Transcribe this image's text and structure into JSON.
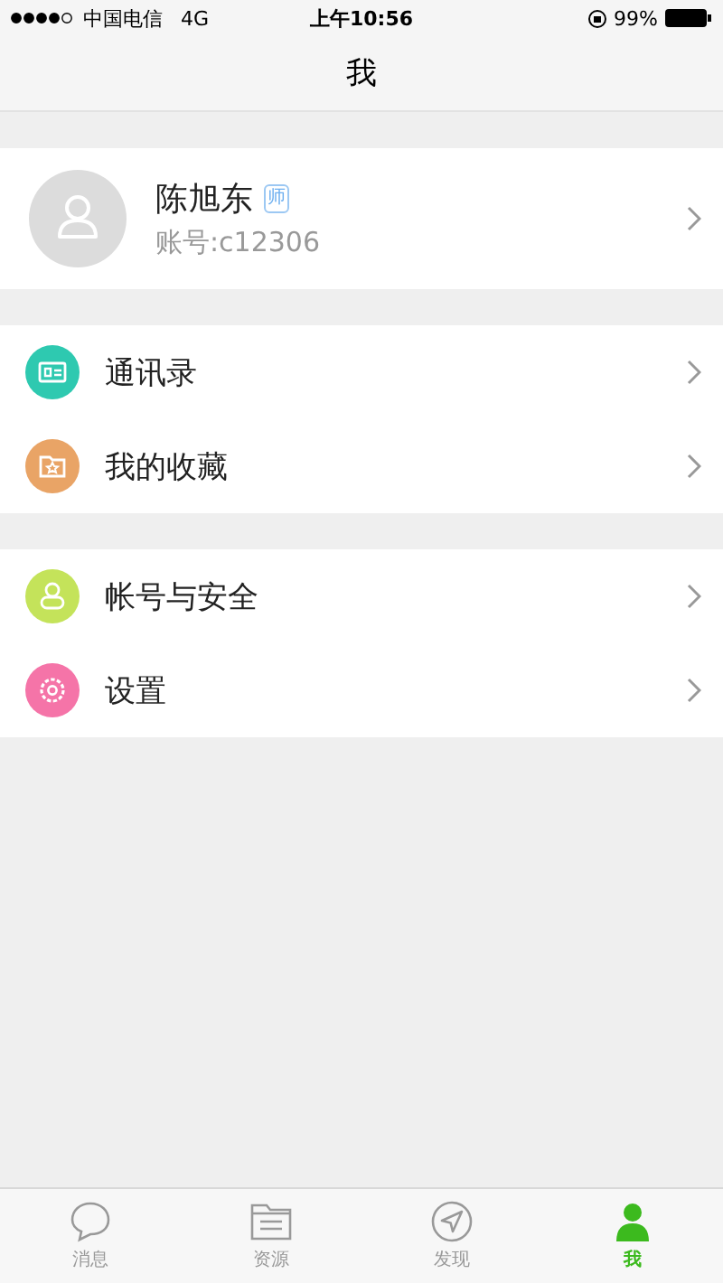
{
  "status_bar": {
    "carrier": "中国电信",
    "network": "4G",
    "time": "上午10:56",
    "battery": "99%"
  },
  "nav": {
    "title": "我"
  },
  "profile": {
    "name": "陈旭东",
    "badge": "师",
    "account": "账号:c12306"
  },
  "groups": [
    [
      {
        "label": "通讯录",
        "kind": "contacts",
        "color": "#2ec9b0"
      },
      {
        "label": "我的收藏",
        "kind": "favorites",
        "color": "#e9a466"
      }
    ],
    [
      {
        "label": "帐号与安全",
        "kind": "account",
        "color": "#c4e35a"
      },
      {
        "label": "设置",
        "kind": "settings",
        "color": "#f574a8"
      }
    ]
  ],
  "tabs": [
    {
      "label": "消息",
      "kind": "messages",
      "selected": false
    },
    {
      "label": "资源",
      "kind": "resources",
      "selected": false
    },
    {
      "label": "发现",
      "kind": "discover",
      "selected": false
    },
    {
      "label": "我",
      "kind": "me",
      "selected": true
    }
  ]
}
